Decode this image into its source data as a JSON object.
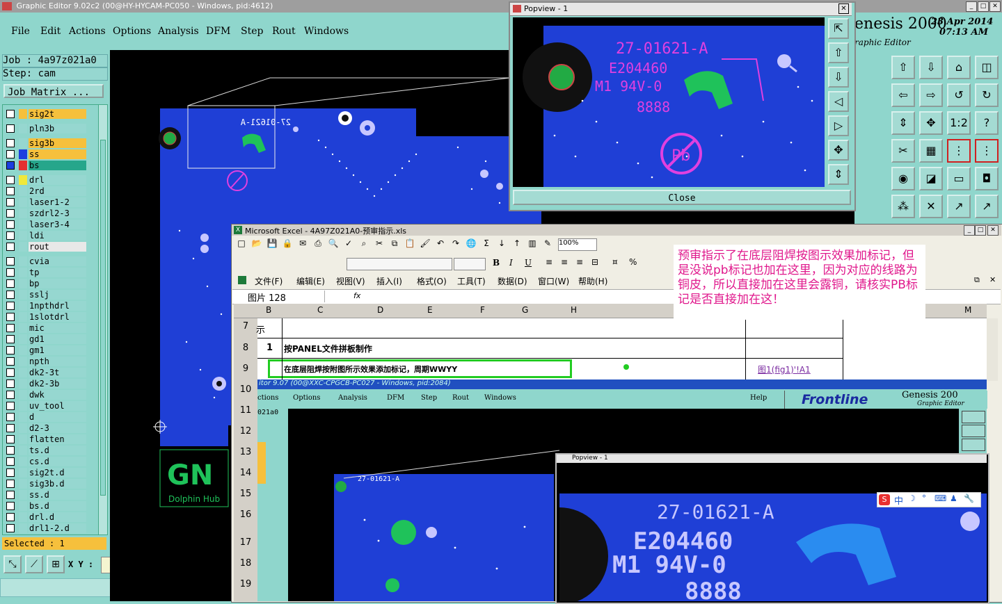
{
  "genesis": {
    "title": "Graphic Editor 9.02c2 (00@HY-HYCAM-PC050 - Windows, pid:4612)",
    "menu": [
      "File",
      "Edit",
      "Actions",
      "Options",
      "Analysis",
      "DFM",
      "Step",
      "Rout",
      "Windows"
    ],
    "brand": "enesis 2000",
    "brand_sub": "raphic Editor",
    "date": "23 Apr 2014",
    "time": "07:13 AM",
    "job": "Job : 4a97z021a0",
    "step": "Step: cam",
    "job_matrix": "Job Matrix ...",
    "selected": "Selected : 1",
    "xy_label": "X Y :",
    "layers": [
      {
        "name": "sig2t",
        "color": "#f6c03c"
      },
      {
        "name": "pln3b",
        "color": "#96d7d0"
      },
      {
        "name": "sig3b",
        "color": "#f6c03c"
      },
      {
        "name": "ss",
        "color": "#f6c03c"
      },
      {
        "name": "bs",
        "color": "#26a68b"
      },
      {
        "name": "drl",
        "color": "#96d7d0"
      },
      {
        "name": "2rd",
        "color": "#96d7d0"
      },
      {
        "name": "laser1-2",
        "color": "#96d7d0"
      },
      {
        "name": "szdrl2-3",
        "color": "#96d7d0"
      },
      {
        "name": "laser3-4",
        "color": "#96d7d0"
      },
      {
        "name": "ldi",
        "color": "#96d7d0"
      },
      {
        "name": "rout",
        "color": "#e8e8e8"
      },
      {
        "name": "cvia",
        "color": "#96d7d0"
      },
      {
        "name": "tp",
        "color": "#96d7d0"
      },
      {
        "name": "bp",
        "color": "#96d7d0"
      },
      {
        "name": "sslj",
        "color": "#96d7d0"
      },
      {
        "name": "1npthdrl",
        "color": "#96d7d0"
      },
      {
        "name": "1slotdrl",
        "color": "#96d7d0"
      },
      {
        "name": "mic",
        "color": "#96d7d0"
      },
      {
        "name": "gd1",
        "color": "#96d7d0"
      },
      {
        "name": "gm1",
        "color": "#96d7d0"
      },
      {
        "name": "npth",
        "color": "#96d7d0"
      },
      {
        "name": "dk2-3t",
        "color": "#96d7d0"
      },
      {
        "name": "dk2-3b",
        "color": "#96d7d0"
      },
      {
        "name": "dwk",
        "color": "#96d7d0"
      },
      {
        "name": "uv_tool",
        "color": "#96d7d0"
      },
      {
        "name": "d",
        "color": "#96d7d0"
      },
      {
        "name": "d2-3",
        "color": "#96d7d0"
      },
      {
        "name": "flatten",
        "color": "#96d7d0"
      },
      {
        "name": "ts.d",
        "color": "#96d7d0"
      },
      {
        "name": "cs.d",
        "color": "#96d7d0"
      },
      {
        "name": "sig2t.d",
        "color": "#96d7d0"
      },
      {
        "name": "sig3b.d",
        "color": "#96d7d0"
      },
      {
        "name": "ss.d",
        "color": "#96d7d0"
      },
      {
        "name": "bs.d",
        "color": "#96d7d0"
      },
      {
        "name": "drl.d",
        "color": "#96d7d0"
      },
      {
        "name": "drl1-2.d",
        "color": "#96d7d0"
      }
    ],
    "board_text": {
      "part": "27-01621-A",
      "code": "E204460",
      "ul": "M1 94V-0",
      "date": "8888",
      "pb": "Pb",
      "logo": "GN",
      "logo_sub": "Dolphin Hub"
    }
  },
  "popview": {
    "title": "Popview - 1",
    "close": "Close"
  },
  "excel": {
    "title": "Microsoft Excel - 4A97Z021A0-预审指示.xls",
    "menu": [
      "文件(F)",
      "编辑(E)",
      "视图(V)",
      "插入(I)",
      "格式(O)",
      "工具(T)",
      "数据(D)",
      "窗口(W)",
      "帮助(H)"
    ],
    "name_box": "图片 128",
    "fx": "fx",
    "zoom": "100%",
    "columns": [
      "B",
      "C",
      "D",
      "E",
      "F",
      "G",
      "H",
      "M"
    ],
    "rows": [
      "7",
      "8",
      "9",
      "10",
      "11",
      "12",
      "13",
      "14",
      "15",
      "16",
      "17",
      "18",
      "19"
    ],
    "cells": {
      "r7_b": "示",
      "r8_b": "1",
      "r8_c": "按PANEL文件拼板制作",
      "r9_c": "在底层阻焊按附图所示效果添加标记，周期WWYY",
      "r9_link": "图1(fig1)'!A1"
    },
    "comment": "预审指示了在底层阻焊按图示效果加标记，但是没说pb标记也加在这里，因为对应的线路为铜皮，所以直接加在这里会露铜，请核实PB标记是否直接加在这！"
  },
  "embedded": {
    "title": "itor 9.07 (00@XXC-CPGCB-PC027 - Windows, pid:2084)",
    "menu": [
      "ctions",
      "Options",
      "Analysis",
      "DFM",
      "Step",
      "Rout",
      "Windows",
      "Help"
    ],
    "frontline": "Frontline",
    "genesis": "Genesis 200",
    "graphic_editor": "Graphic Editor",
    "job_partial": "021a0",
    "popview_title": "Popview - 1",
    "ime": "中"
  }
}
